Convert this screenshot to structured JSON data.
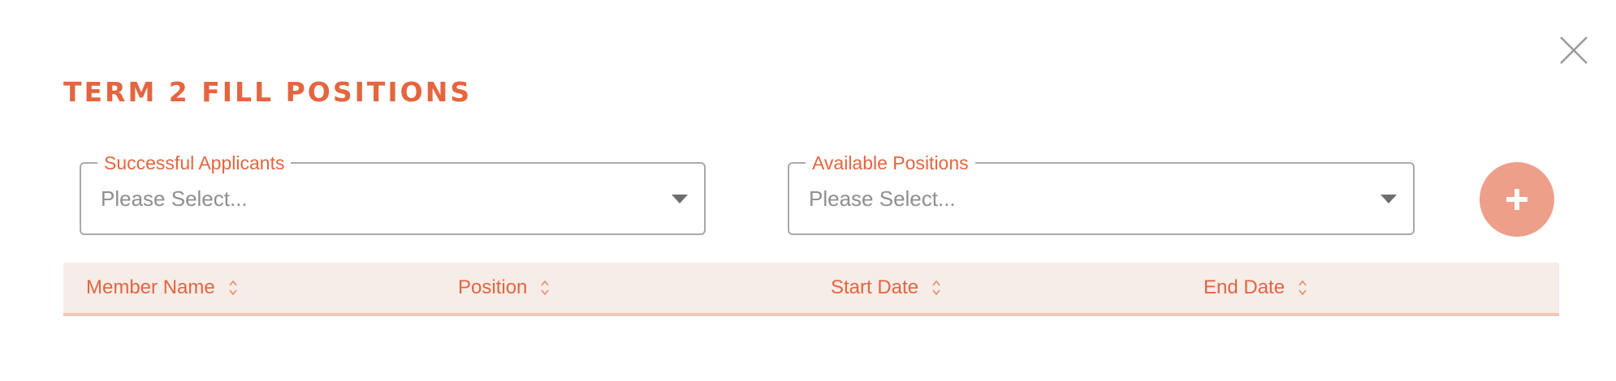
{
  "dialog": {
    "title": "TERM 2 FILL POSITIONS",
    "close_icon": "close-icon"
  },
  "selectors": {
    "successful_applicants": {
      "label": "Successful Applicants",
      "value": "Please Select...",
      "icon": "caret-down-icon"
    },
    "available_positions": {
      "label": "Available Positions",
      "value": "Please Select...",
      "icon": "caret-down-icon"
    }
  },
  "add_button": {
    "icon": "plus-icon"
  },
  "table": {
    "columns": [
      {
        "label": "Member Name",
        "icon": "sort-icon"
      },
      {
        "label": "Position",
        "icon": "sort-icon"
      },
      {
        "label": "Start Date",
        "icon": "sort-icon"
      },
      {
        "label": "End Date",
        "icon": "sort-icon"
      }
    ],
    "rows": []
  },
  "colors": {
    "accent": "#e4653f",
    "add_button_bg": "#ee9f89",
    "table_header_bg": "#f6ece8",
    "table_header_border": "#f1c7b4",
    "field_border": "#a9a9a9",
    "placeholder": "#8f8f8f"
  }
}
